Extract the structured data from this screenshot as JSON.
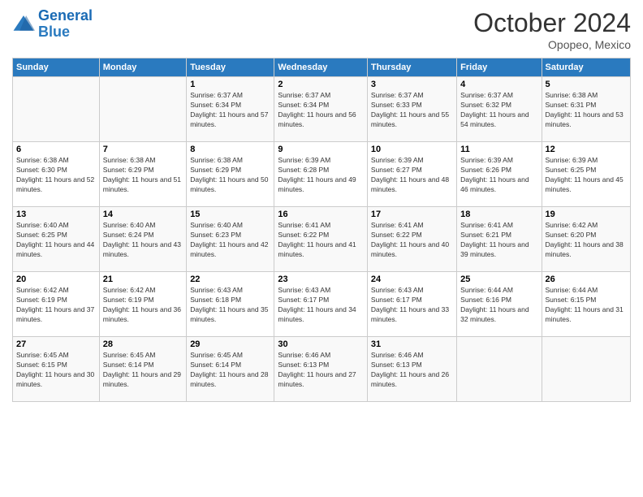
{
  "header": {
    "logo_general": "General",
    "logo_blue": "Blue",
    "month_title": "October 2024",
    "subtitle": "Opopeo, Mexico"
  },
  "days_of_week": [
    "Sunday",
    "Monday",
    "Tuesday",
    "Wednesday",
    "Thursday",
    "Friday",
    "Saturday"
  ],
  "weeks": [
    [
      {
        "num": "",
        "info": ""
      },
      {
        "num": "",
        "info": ""
      },
      {
        "num": "1",
        "info": "Sunrise: 6:37 AM\nSunset: 6:34 PM\nDaylight: 11 hours and 57 minutes."
      },
      {
        "num": "2",
        "info": "Sunrise: 6:37 AM\nSunset: 6:34 PM\nDaylight: 11 hours and 56 minutes."
      },
      {
        "num": "3",
        "info": "Sunrise: 6:37 AM\nSunset: 6:33 PM\nDaylight: 11 hours and 55 minutes."
      },
      {
        "num": "4",
        "info": "Sunrise: 6:37 AM\nSunset: 6:32 PM\nDaylight: 11 hours and 54 minutes."
      },
      {
        "num": "5",
        "info": "Sunrise: 6:38 AM\nSunset: 6:31 PM\nDaylight: 11 hours and 53 minutes."
      }
    ],
    [
      {
        "num": "6",
        "info": "Sunrise: 6:38 AM\nSunset: 6:30 PM\nDaylight: 11 hours and 52 minutes."
      },
      {
        "num": "7",
        "info": "Sunrise: 6:38 AM\nSunset: 6:29 PM\nDaylight: 11 hours and 51 minutes."
      },
      {
        "num": "8",
        "info": "Sunrise: 6:38 AM\nSunset: 6:29 PM\nDaylight: 11 hours and 50 minutes."
      },
      {
        "num": "9",
        "info": "Sunrise: 6:39 AM\nSunset: 6:28 PM\nDaylight: 11 hours and 49 minutes."
      },
      {
        "num": "10",
        "info": "Sunrise: 6:39 AM\nSunset: 6:27 PM\nDaylight: 11 hours and 48 minutes."
      },
      {
        "num": "11",
        "info": "Sunrise: 6:39 AM\nSunset: 6:26 PM\nDaylight: 11 hours and 46 minutes."
      },
      {
        "num": "12",
        "info": "Sunrise: 6:39 AM\nSunset: 6:25 PM\nDaylight: 11 hours and 45 minutes."
      }
    ],
    [
      {
        "num": "13",
        "info": "Sunrise: 6:40 AM\nSunset: 6:25 PM\nDaylight: 11 hours and 44 minutes."
      },
      {
        "num": "14",
        "info": "Sunrise: 6:40 AM\nSunset: 6:24 PM\nDaylight: 11 hours and 43 minutes."
      },
      {
        "num": "15",
        "info": "Sunrise: 6:40 AM\nSunset: 6:23 PM\nDaylight: 11 hours and 42 minutes."
      },
      {
        "num": "16",
        "info": "Sunrise: 6:41 AM\nSunset: 6:22 PM\nDaylight: 11 hours and 41 minutes."
      },
      {
        "num": "17",
        "info": "Sunrise: 6:41 AM\nSunset: 6:22 PM\nDaylight: 11 hours and 40 minutes."
      },
      {
        "num": "18",
        "info": "Sunrise: 6:41 AM\nSunset: 6:21 PM\nDaylight: 11 hours and 39 minutes."
      },
      {
        "num": "19",
        "info": "Sunrise: 6:42 AM\nSunset: 6:20 PM\nDaylight: 11 hours and 38 minutes."
      }
    ],
    [
      {
        "num": "20",
        "info": "Sunrise: 6:42 AM\nSunset: 6:19 PM\nDaylight: 11 hours and 37 minutes."
      },
      {
        "num": "21",
        "info": "Sunrise: 6:42 AM\nSunset: 6:19 PM\nDaylight: 11 hours and 36 minutes."
      },
      {
        "num": "22",
        "info": "Sunrise: 6:43 AM\nSunset: 6:18 PM\nDaylight: 11 hours and 35 minutes."
      },
      {
        "num": "23",
        "info": "Sunrise: 6:43 AM\nSunset: 6:17 PM\nDaylight: 11 hours and 34 minutes."
      },
      {
        "num": "24",
        "info": "Sunrise: 6:43 AM\nSunset: 6:17 PM\nDaylight: 11 hours and 33 minutes."
      },
      {
        "num": "25",
        "info": "Sunrise: 6:44 AM\nSunset: 6:16 PM\nDaylight: 11 hours and 32 minutes."
      },
      {
        "num": "26",
        "info": "Sunrise: 6:44 AM\nSunset: 6:15 PM\nDaylight: 11 hours and 31 minutes."
      }
    ],
    [
      {
        "num": "27",
        "info": "Sunrise: 6:45 AM\nSunset: 6:15 PM\nDaylight: 11 hours and 30 minutes."
      },
      {
        "num": "28",
        "info": "Sunrise: 6:45 AM\nSunset: 6:14 PM\nDaylight: 11 hours and 29 minutes."
      },
      {
        "num": "29",
        "info": "Sunrise: 6:45 AM\nSunset: 6:14 PM\nDaylight: 11 hours and 28 minutes."
      },
      {
        "num": "30",
        "info": "Sunrise: 6:46 AM\nSunset: 6:13 PM\nDaylight: 11 hours and 27 minutes."
      },
      {
        "num": "31",
        "info": "Sunrise: 6:46 AM\nSunset: 6:13 PM\nDaylight: 11 hours and 26 minutes."
      },
      {
        "num": "",
        "info": ""
      },
      {
        "num": "",
        "info": ""
      }
    ]
  ]
}
